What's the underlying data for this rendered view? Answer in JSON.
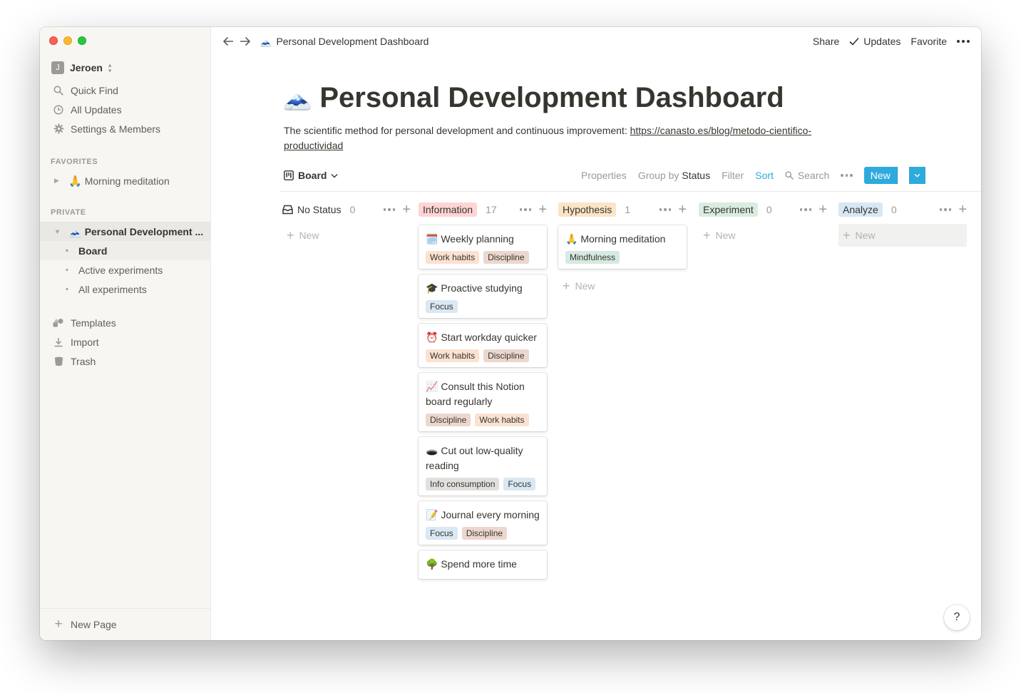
{
  "sidebar": {
    "workspace": {
      "initial": "J",
      "name": "Jeroen"
    },
    "nav": [
      {
        "label": "Quick Find",
        "icon": "search-icon"
      },
      {
        "label": "All Updates",
        "icon": "clock-icon"
      },
      {
        "label": "Settings & Members",
        "icon": "gear-icon"
      }
    ],
    "favorites_header": "FAVORITES",
    "favorites": [
      {
        "emoji": "🙏",
        "label": "Morning meditation"
      }
    ],
    "private_header": "PRIVATE",
    "private_page": {
      "emoji": "🗻",
      "label": "Personal Development ..."
    },
    "sub_pages": [
      "Board",
      "Active experiments",
      "All experiments"
    ],
    "tools": [
      {
        "label": "Templates",
        "icon": "shapes-icon"
      },
      {
        "label": "Import",
        "icon": "download-icon"
      },
      {
        "label": "Trash",
        "icon": "trash-icon"
      }
    ],
    "new_page": "New Page"
  },
  "topbar": {
    "breadcrumb_emoji": "🗻",
    "breadcrumb": "Personal Development Dashboard",
    "share": "Share",
    "updates": "Updates",
    "favorite": "Favorite"
  },
  "page": {
    "emoji": "🗻",
    "title": "Personal Development Dashboard",
    "description": "The scientific method for personal development and continuous improvement: ",
    "link": "https://canasto.es/blog/metodo-cientifico-productividad"
  },
  "view": {
    "name": "Board",
    "properties": "Properties",
    "group_by_prefix": "Group by",
    "group_by_value": "Status",
    "filter": "Filter",
    "sort": "Sort",
    "search": "Search",
    "new": "New"
  },
  "board": {
    "new_label": "New",
    "columns": [
      {
        "title": "No Status",
        "count": "0",
        "color": "none",
        "cards": []
      },
      {
        "title": "Information",
        "count": "17",
        "color": "#ffd4d4",
        "cards": [
          {
            "emoji": "🗓️",
            "title": "Weekly planning",
            "tags": [
              "Work habits",
              "Discipline"
            ]
          },
          {
            "emoji": "🎓",
            "title": "Proactive studying",
            "tags": [
              "Focus"
            ]
          },
          {
            "emoji": "⏰",
            "title": "Start workday quicker",
            "tags": [
              "Work habits",
              "Discipline"
            ]
          },
          {
            "emoji": "📈",
            "title": "Consult this Notion board regularly",
            "tags": [
              "Discipline",
              "Work habits"
            ]
          },
          {
            "emoji": "🕳️",
            "title": "Cut out low-quality reading",
            "tags": [
              "Info consumption",
              "Focus"
            ]
          },
          {
            "emoji": "📝",
            "title": "Journal every morning",
            "tags": [
              "Focus",
              "Discipline"
            ]
          },
          {
            "emoji": "🌳",
            "title": "Spend more time",
            "tags": []
          }
        ]
      },
      {
        "title": "Hypothesis",
        "count": "1",
        "color": "#fbe4c7",
        "cards": [
          {
            "emoji": "🙏",
            "title": "Morning meditation",
            "tags": [
              "Mindfulness"
            ]
          }
        ]
      },
      {
        "title": "Experiment",
        "count": "0",
        "color": "#d9ecdf",
        "cards": []
      },
      {
        "title": "Analyze",
        "count": "0",
        "color": "#d8e7f4",
        "cards": []
      }
    ]
  },
  "help": "?"
}
